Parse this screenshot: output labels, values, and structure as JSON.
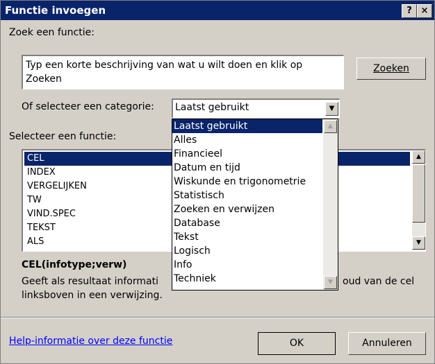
{
  "window": {
    "title": "Functie invoegen",
    "help_glyph": "?",
    "close_glyph": "×"
  },
  "search": {
    "label": "Zoek een functie:",
    "value": "Typ een korte beschrijving van wat u wilt doen en klik op Zoeken",
    "button": "Zoeken"
  },
  "category": {
    "label": "Of selecteer een categorie:",
    "selected": "Laatst gebruikt",
    "options": [
      "Laatst gebruikt",
      "Alles",
      "Financieel",
      "Datum en tijd",
      "Wiskunde en trigonometrie",
      "Statistisch",
      "Zoeken en verwijzen",
      "Database",
      "Tekst",
      "Logisch",
      "Info",
      "Techniek"
    ]
  },
  "functions": {
    "label": "Selecteer een functie:",
    "items": [
      "CEL",
      "INDEX",
      "VERGELIJKEN",
      "TW",
      "VIND.SPEC",
      "TEKST",
      "ALS"
    ]
  },
  "description": {
    "signature": "CEL(infotype;verw)",
    "text_line1_left": "Geeft als resultaat informati",
    "text_line1_right": "oud van de cel",
    "text_line2": "linksboven in een verwijzing."
  },
  "footer": {
    "help_link": "Help-informatie over deze functie",
    "ok": "OK",
    "cancel": "Annuleren"
  },
  "colors": {
    "titlebar": "#0a246a",
    "selection": "#0a246a",
    "face": "#d4d0c8"
  }
}
